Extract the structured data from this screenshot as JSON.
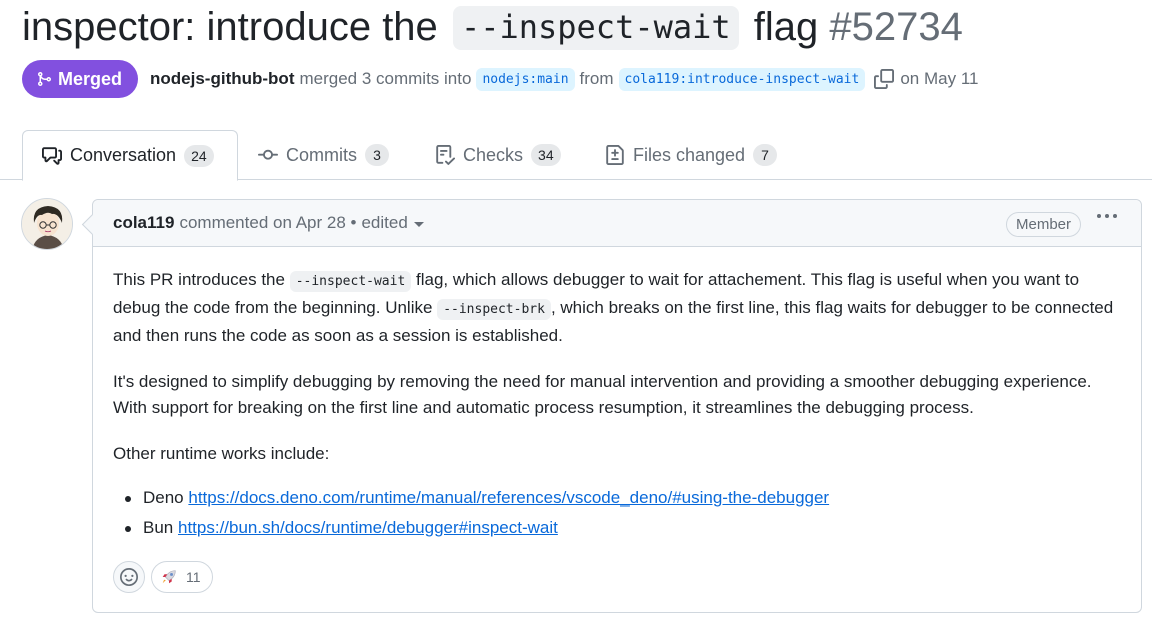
{
  "pr": {
    "title_prefix": "inspector: introduce the",
    "title_code": "--inspect-wait",
    "title_suffix": "flag",
    "number": "#52734",
    "state": "Merged",
    "author": "nodejs-github-bot",
    "action_text": "merged 3 commits into",
    "base_branch": "nodejs:main",
    "from_text": "from",
    "head_branch": "cola119:introduce-inspect-wait",
    "date_text": "on May 11"
  },
  "tabs": [
    {
      "label": "Conversation",
      "count": "24",
      "icon": "comment-discussion-icon"
    },
    {
      "label": "Commits",
      "count": "3",
      "icon": "git-commit-icon"
    },
    {
      "label": "Checks",
      "count": "34",
      "icon": "checklist-icon"
    },
    {
      "label": "Files changed",
      "count": "7",
      "icon": "file-diff-icon"
    }
  ],
  "comment": {
    "author": "cola119",
    "meta": "commented on Apr 28 •",
    "edited": "edited",
    "role": "Member",
    "p1_a": "This PR introduces the",
    "p1_code1": "--inspect-wait",
    "p1_b": "flag, which allows debugger to wait for attachement. This flag is useful when you want to debug the code from the beginning. Unlike",
    "p1_code2": "--inspect-brk",
    "p1_c": ", which breaks on the first line, this flag waits for debugger to be connected and then runs the code as soon as a session is established.",
    "p2": "It's designed to simplify debugging by removing the need for manual intervention and providing a smoother debugging experience. With support for breaking on the first line and automatic process resumption, it streamlines the debugging process.",
    "p3": "Other runtime works include:",
    "list": [
      {
        "name": "Deno",
        "url": "https://docs.deno.com/runtime/manual/references/vscode_deno/#using-the-debugger"
      },
      {
        "name": "Bun",
        "url": "https://bun.sh/docs/runtime/debugger#inspect-wait"
      }
    ],
    "reactions": {
      "rocket_count": "11"
    }
  },
  "colors": {
    "merged": "#8250df",
    "link": "#0969da",
    "branch_bg": "#ddf4ff"
  }
}
